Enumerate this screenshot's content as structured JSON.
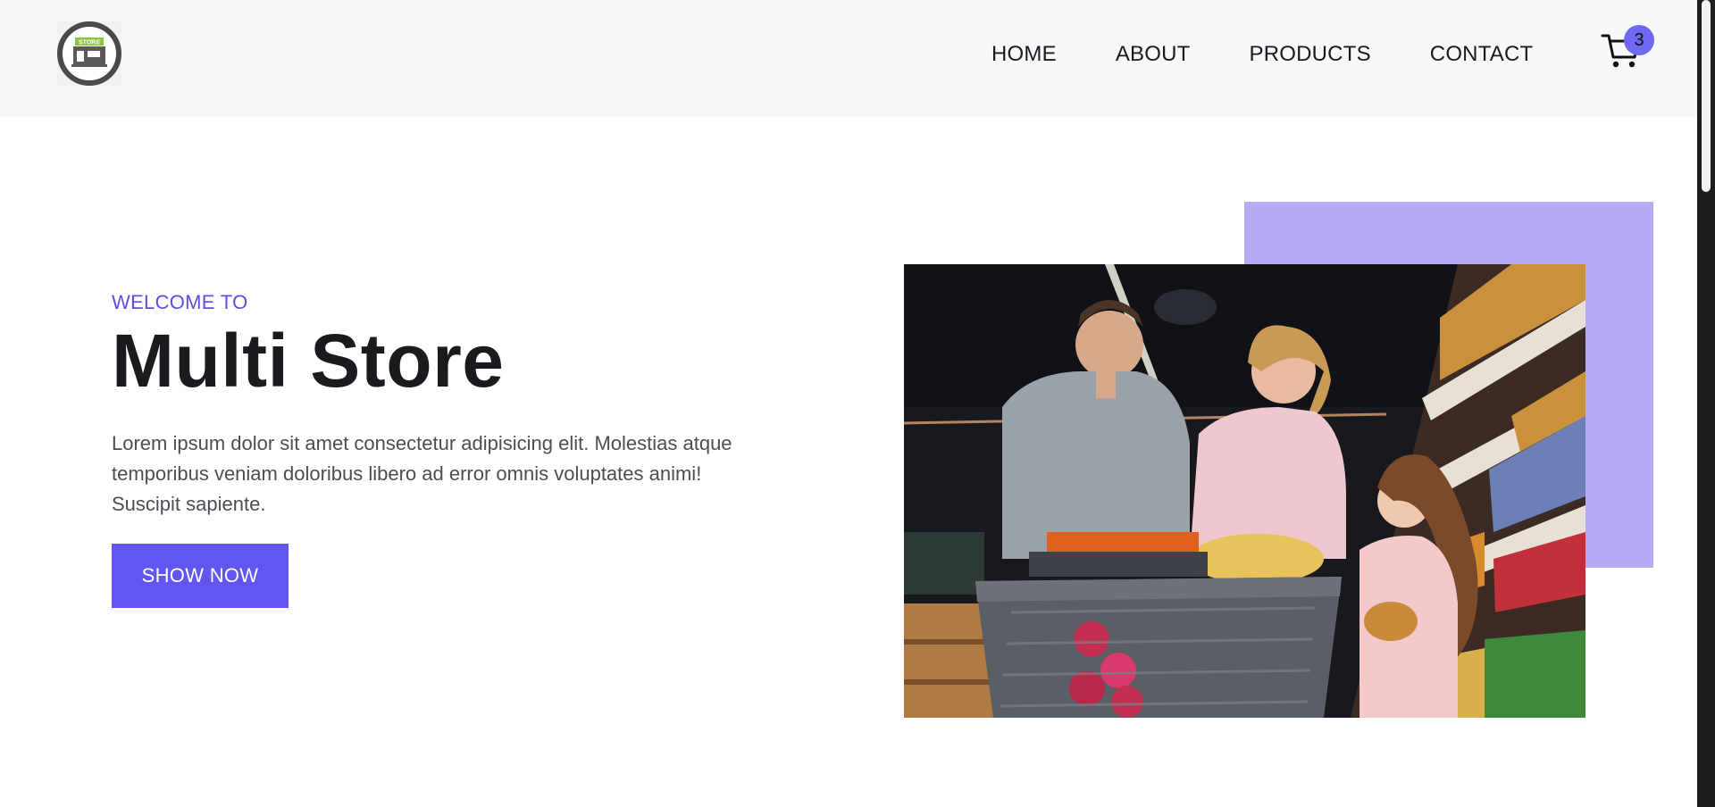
{
  "header": {
    "logo": {
      "text": "STORE",
      "icon": "store-logo-icon"
    },
    "nav": [
      {
        "label": "HOME"
      },
      {
        "label": "ABOUT"
      },
      {
        "label": "PRODUCTS"
      },
      {
        "label": "CONTACT"
      }
    ],
    "cart": {
      "icon": "cart-icon",
      "count": "3"
    }
  },
  "hero": {
    "eyebrow": "WELCOME TO",
    "title": "Multi Store",
    "description": "Lorem ipsum dolor sit amet consectetur adipisicing elit. Molestias atque temporibus veniam doloribus libero ad error omnis voluptates animi! Suscipit sapiente.",
    "cta_label": "SHOW NOW",
    "image": "family-shopping-photo"
  },
  "colors": {
    "accent": "#6355f0",
    "accent_light": "#b7abf5",
    "eyebrow": "#5a50e8",
    "header_bg": "#f7f8f9"
  }
}
